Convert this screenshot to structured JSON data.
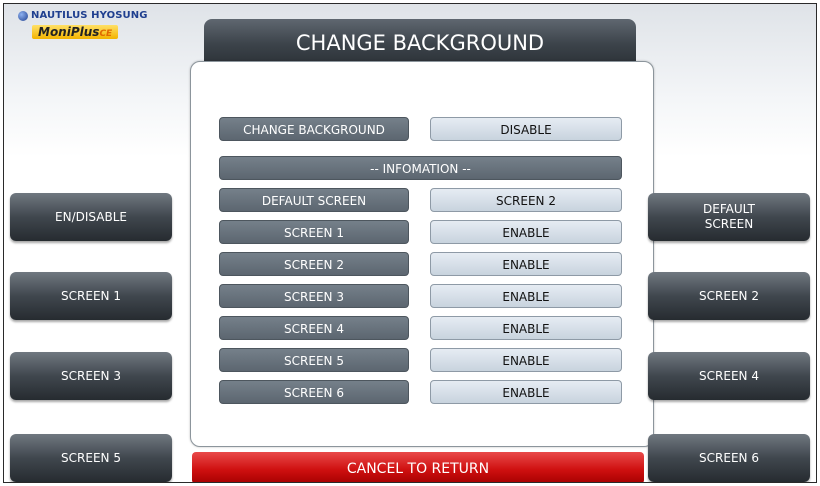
{
  "logo": {
    "brand": "NAUTILUS HYOSUNG",
    "product": "MoniPlus",
    "product_suffix": "CE"
  },
  "title": "CHANGE BACKGROUND",
  "setting": {
    "label": "CHANGE BACKGROUND",
    "value": "DISABLE"
  },
  "info_header": "-- INFOMATION --",
  "default_screen": {
    "label": "DEFAULT SCREEN",
    "value": "SCREEN 2"
  },
  "screens": [
    {
      "label": "SCREEN 1",
      "value": "ENABLE"
    },
    {
      "label": "SCREEN 2",
      "value": "ENABLE"
    },
    {
      "label": "SCREEN 3",
      "value": "ENABLE"
    },
    {
      "label": "SCREEN 4",
      "value": "ENABLE"
    },
    {
      "label": "SCREEN 5",
      "value": "ENABLE"
    },
    {
      "label": "SCREEN 6",
      "value": "ENABLE"
    }
  ],
  "left_buttons": [
    "EN/DISABLE",
    "SCREEN 1",
    "SCREEN 3",
    "SCREEN 5"
  ],
  "right_buttons": [
    "DEFAULT\nSCREEN",
    "SCREEN 2",
    "SCREEN 4",
    "SCREEN 6"
  ],
  "cancel_label": "CANCEL TO RETURN"
}
